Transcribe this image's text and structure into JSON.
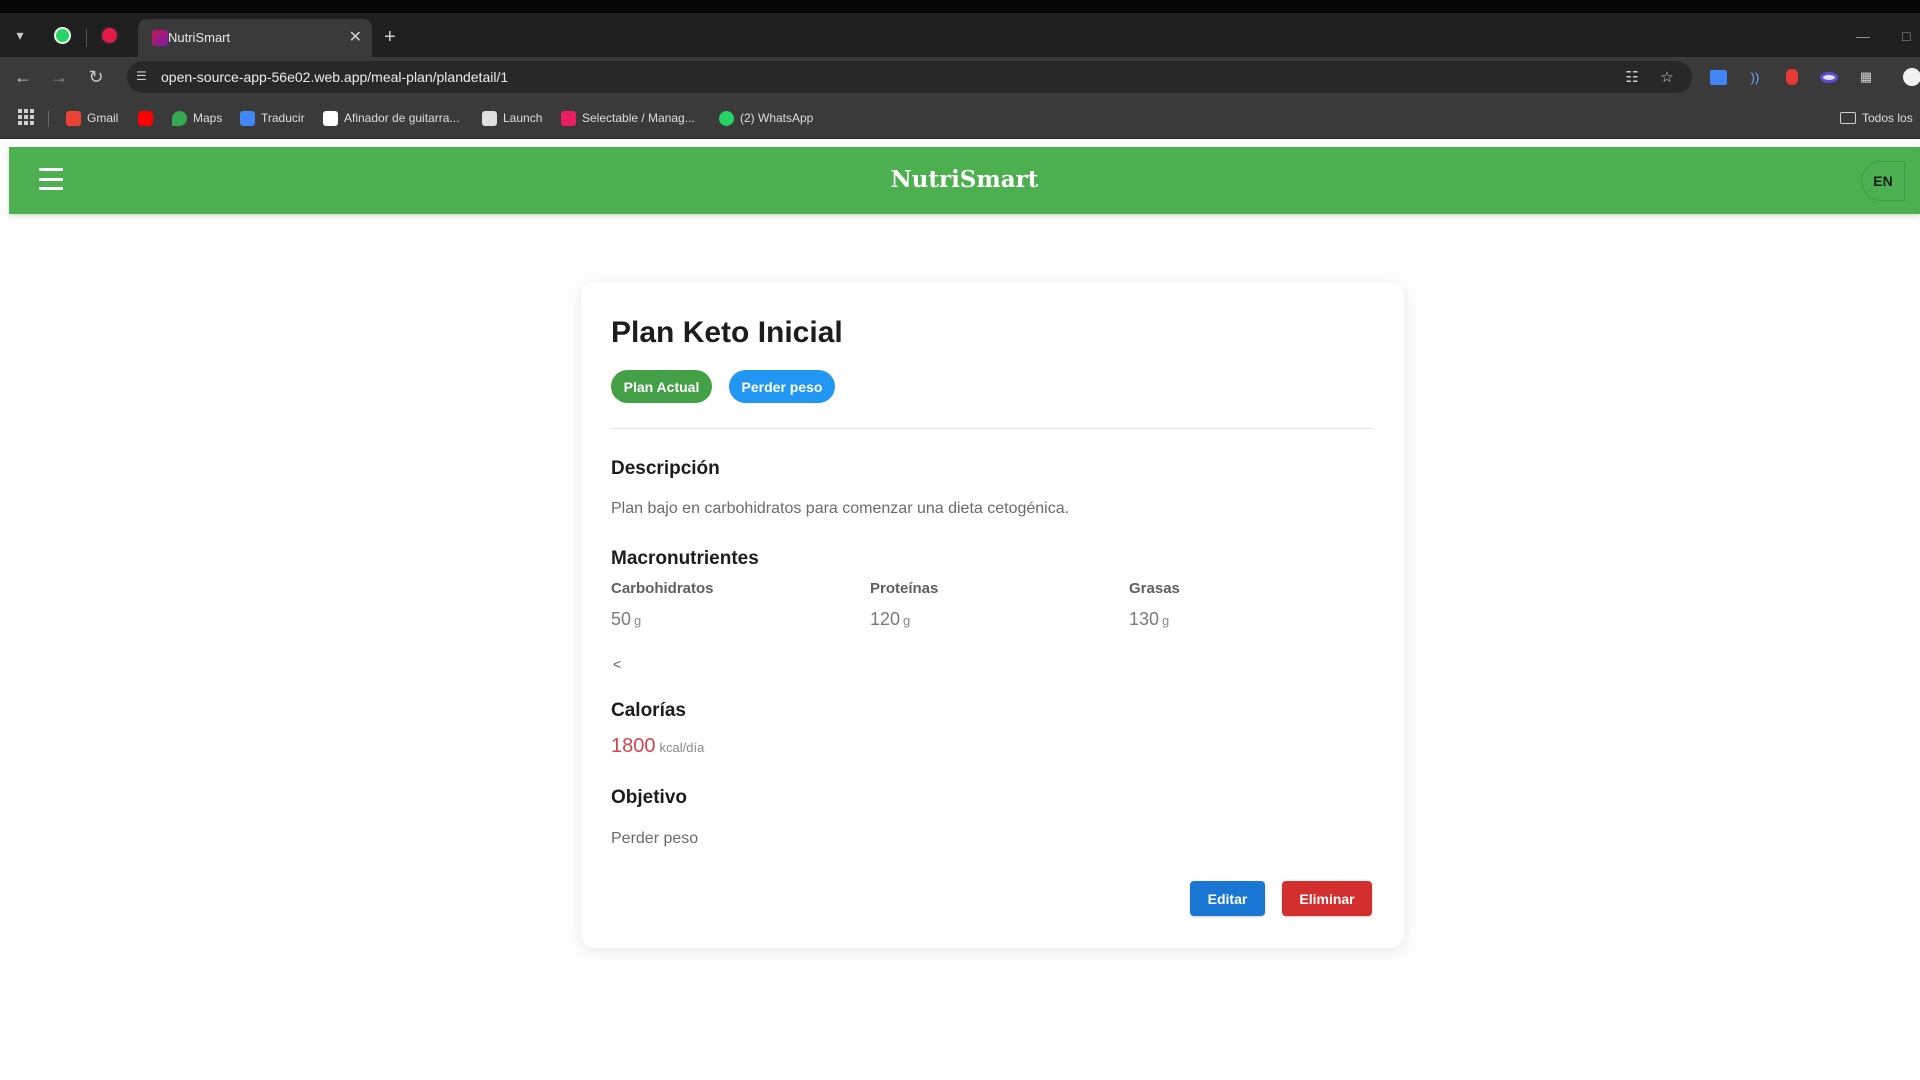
{
  "browser": {
    "tab_title": "NutriSmart",
    "url": "open-source-app-56e02.web.app/meal-plan/plandetail/1",
    "bookmarks": [
      {
        "label": "Gmail",
        "color": "#ea4335"
      },
      {
        "label": "",
        "color": "#ff0000"
      },
      {
        "label": "Maps",
        "color": "#34a853"
      },
      {
        "label": "Traducir",
        "color": "#4285f4"
      },
      {
        "label": "Afinador de guitarra...",
        "color": "#ffffff"
      },
      {
        "label": "Launch",
        "color": "#e0e0e0"
      },
      {
        "label": "Selectable / Manag...",
        "color": "#e91e63"
      },
      {
        "label": "(2) WhatsApp",
        "color": "#25d366"
      }
    ],
    "bookmarks_folder": "Todos los"
  },
  "app": {
    "brand": "NutriSmart",
    "lang": "EN",
    "accent_color": "#4caf50"
  },
  "plan": {
    "title": "Plan Keto Inicial",
    "badges": [
      {
        "label": "Plan Actual",
        "color": "#43a047"
      },
      {
        "label": "Perder peso",
        "color": "#2196f3"
      }
    ],
    "description_title": "Descripción",
    "description": "Plan bajo en carbohidratos para comenzar una dieta cetogénica.",
    "macros_title": "Macronutrientes",
    "macros": [
      {
        "label": "Carbohidratos",
        "value": "50",
        "unit": "g"
      },
      {
        "label": "Proteínas",
        "value": "120",
        "unit": "g"
      },
      {
        "label": "Grasas",
        "value": "130",
        "unit": "g"
      }
    ],
    "stray_text": "<",
    "calories_title": "Calorías",
    "calories_value": "1800",
    "calories_unit": "kcal/día",
    "objective_title": "Objetivo",
    "objective": "Perder peso",
    "edit_label": "Editar",
    "delete_label": "Eliminar",
    "edit_color": "#1976d2",
    "delete_color": "#d32f2f"
  }
}
